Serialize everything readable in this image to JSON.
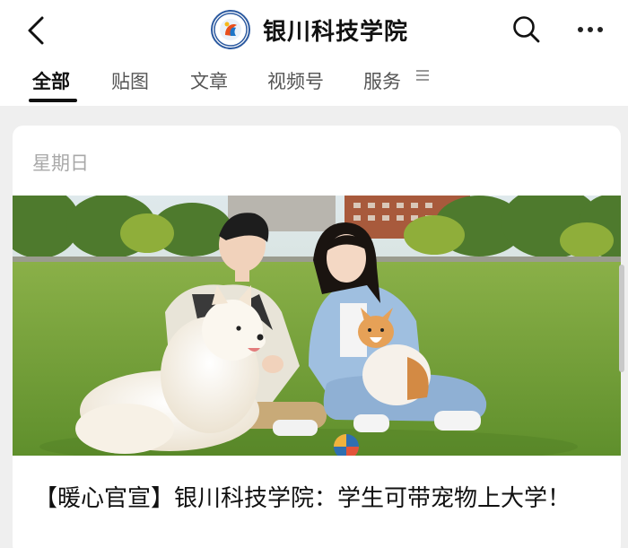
{
  "header": {
    "title": "银川科技学院",
    "back_icon": "chevron-left-icon",
    "search_icon": "search-icon",
    "more_icon": "more-horizontal-icon"
  },
  "tabs": [
    {
      "label": "全部",
      "active": true
    },
    {
      "label": "贴图",
      "active": false
    },
    {
      "label": "文章",
      "active": false
    },
    {
      "label": "视频号",
      "active": false
    },
    {
      "label": "服务",
      "active": false
    }
  ],
  "post": {
    "date": "星期日",
    "image_icon": "photo-students-with-pets",
    "headline": "【暖心官宣】银川科技学院：学生可带宠物上大学！"
  },
  "colors": {
    "background": "#efefef",
    "card": "#ffffff",
    "grass": "#6f9e38",
    "sky": "#cfe0e6"
  }
}
